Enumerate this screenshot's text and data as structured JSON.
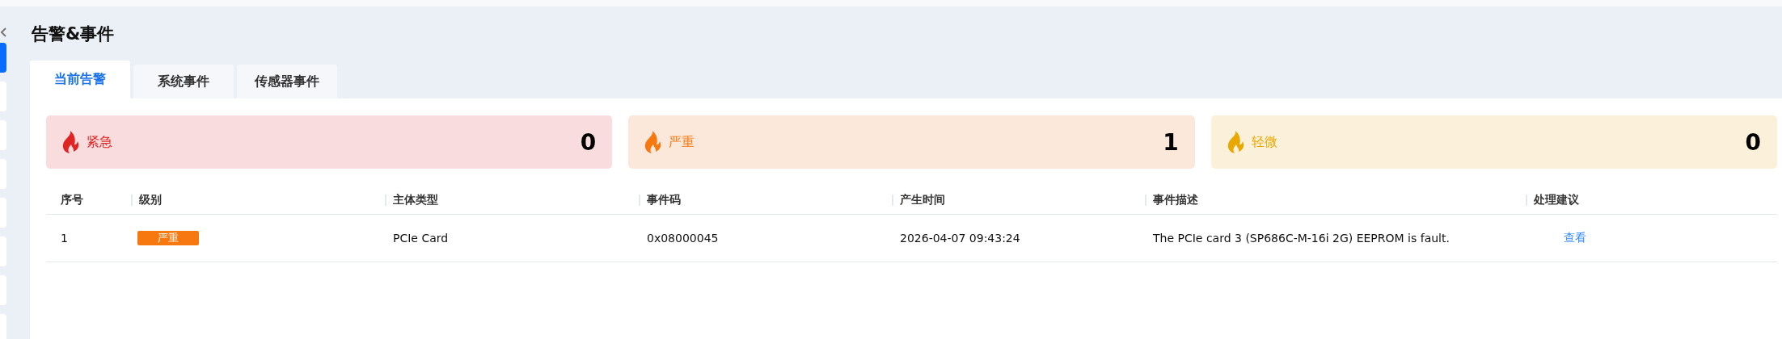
{
  "sidebar": {
    "items": [
      {
        "selected": true
      },
      {
        "selected": false
      },
      {
        "selected": false
      },
      {
        "selected": false
      },
      {
        "selected": false
      },
      {
        "selected": false
      },
      {
        "selected": false
      },
      {
        "selected": false
      }
    ]
  },
  "page": {
    "title": "告警&事件"
  },
  "tabs": [
    {
      "label": "当前告警",
      "selected": true
    },
    {
      "label": "系统事件",
      "selected": false
    },
    {
      "label": "传感器事件",
      "selected": false
    }
  ],
  "summary_cards": [
    {
      "kind": "critical",
      "label": "紧急",
      "count": "0"
    },
    {
      "kind": "major",
      "label": "严重",
      "count": "1"
    },
    {
      "kind": "minor",
      "label": "轻微",
      "count": "0"
    }
  ],
  "table": {
    "columns": [
      "序号",
      "级别",
      "主体类型",
      "事件码",
      "产生时间",
      "事件描述",
      "处理建议"
    ],
    "rows": [
      {
        "index": "1",
        "level": {
          "kind": "major",
          "label": "严重"
        },
        "subject_type": "PCIe Card",
        "event_code": "0x08000045",
        "time": "2026-04-07 09:43:24",
        "description": "The PCIe card 3 (SP686C-M-16i 2G) EEPROM is fault.",
        "action": "查看"
      }
    ]
  }
}
